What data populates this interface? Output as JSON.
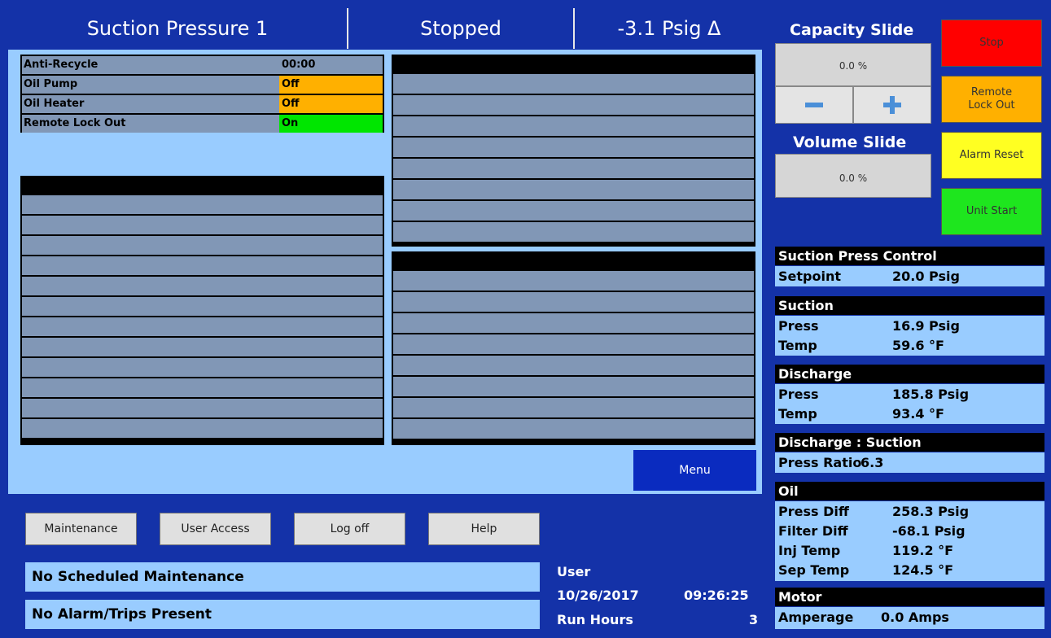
{
  "header": {
    "title": "Suction Pressure 1",
    "state": "Stopped",
    "delta": "-3.1 Psig Δ"
  },
  "status": [
    {
      "label": "Anti-Recycle",
      "value": "00:00",
      "color": "#8197b6"
    },
    {
      "label": "Oil Pump",
      "value": "Off",
      "color": "#ffb000"
    },
    {
      "label": "Oil Heater",
      "value": "Off",
      "color": "#ffb000"
    },
    {
      "label": "Remote Lock Out",
      "value": "On",
      "color": "#00e600"
    }
  ],
  "menu_label": "Menu",
  "bottom_buttons": {
    "maintenance": "Maintenance",
    "user_access": "User Access",
    "log_off": "Log off",
    "help": "Help"
  },
  "messages": {
    "maintenance": "No Scheduled Maintenance",
    "alarms": "No Alarm/Trips Present"
  },
  "session": {
    "user": "User",
    "date": "10/26/2017",
    "time": "09:26:25",
    "run_hours_label": "Run Hours",
    "run_hours": "3"
  },
  "capacity_slide": {
    "title": "Capacity Slide",
    "value": "0.0 %"
  },
  "volume_slide": {
    "title": "Volume Slide",
    "value": "0.0 %"
  },
  "commands": {
    "stop": "Stop",
    "remote_lock_out": "Remote Lock Out",
    "alarm_reset": "Alarm Reset",
    "unit_start": "Unit Start"
  },
  "colors": {
    "background": "#1432a8",
    "panel": "#99ccff",
    "grid_row": "#8197b6",
    "stop": "#ff0000",
    "remote_lock_out": "#ffb000",
    "alarm_reset": "#ffff22",
    "unit_start": "#1ee61e"
  },
  "sections": {
    "suction_press_control": {
      "title": "Suction Press Control",
      "setpoint_label": "Setpoint",
      "setpoint": "20.0 Psig"
    },
    "suction": {
      "title": "Suction",
      "press_label": "Press",
      "press": "16.9 Psig",
      "temp_label": "Temp",
      "temp": "59.6 °F"
    },
    "discharge": {
      "title": "Discharge",
      "press_label": "Press",
      "press": "185.8 Psig",
      "temp_label": "Temp",
      "temp": "93.4 °F"
    },
    "ratio": {
      "title": "Discharge : Suction",
      "label": "Press Ratio",
      "value": "6.3"
    },
    "oil": {
      "title": "Oil",
      "press_diff_label": "Press Diff",
      "press_diff": "258.3 Psig",
      "filter_diff_label": "Filter Diff",
      "filter_diff": "-68.1 Psig",
      "inj_temp_label": "Inj Temp",
      "inj_temp": "119.2 °F",
      "sep_temp_label": "Sep Temp",
      "sep_temp": "124.5 °F"
    },
    "motor": {
      "title": "Motor",
      "amperage_label": "Amperage",
      "amperage": "0.0 Amps"
    }
  }
}
